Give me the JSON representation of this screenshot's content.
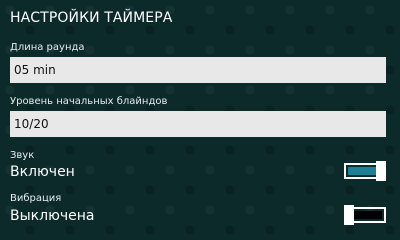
{
  "page": {
    "title": "НАСТРОЙКИ ТАЙМЕРА"
  },
  "round_length": {
    "label": "Длина раунда",
    "value": "05 min"
  },
  "blinds": {
    "label": "Уровень начальных блайндов",
    "value": "10/20"
  },
  "sound": {
    "label": "Звук",
    "state_text": "Включен",
    "on": true
  },
  "vibration": {
    "label": "Вибрация",
    "state_text": "Выключена",
    "on": false
  },
  "colors": {
    "background": "#0c2a2a",
    "toggle_on_fill": "#1a8196",
    "toggle_off_fill": "#000000",
    "field_background": "#e8e8e8"
  }
}
